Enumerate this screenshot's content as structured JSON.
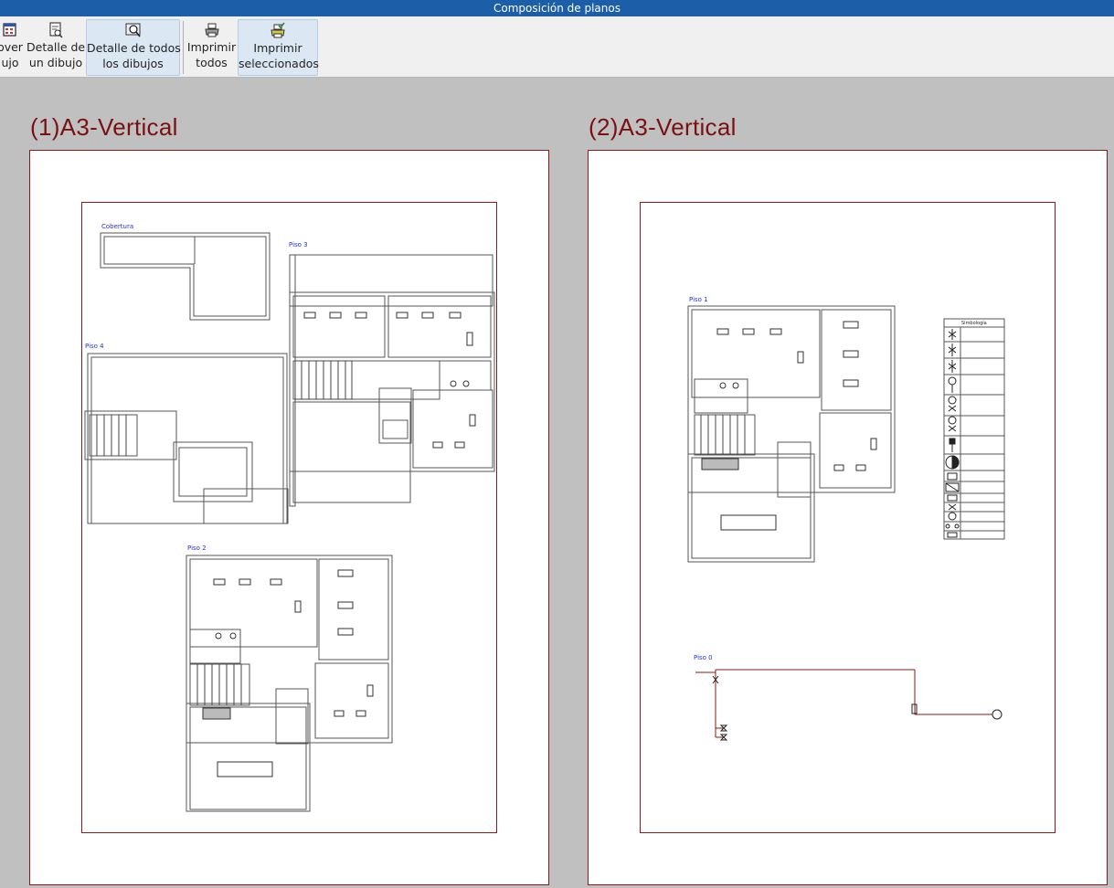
{
  "window": {
    "title": "Composición de planos"
  },
  "toolbar": {
    "move": {
      "line1": "over",
      "line2": "ujo"
    },
    "detail_one": {
      "line1": "Detalle de",
      "line2": "un dibujo"
    },
    "detail_all": {
      "line1": "Detalle de todos",
      "line2": "los dibujos"
    },
    "print_all": {
      "line1": "Imprimir",
      "line2": "todos"
    },
    "print_selected": {
      "line1": "Imprimir",
      "line2": "seleccionados"
    }
  },
  "sheets": [
    {
      "title": "(1)A3-Vertical"
    },
    {
      "title": "(2)A3-Vertical"
    }
  ],
  "drawings": {
    "cobertura": "Cobertura",
    "piso3": "Piso 3",
    "piso4": "Piso 4",
    "piso2": "Piso 2",
    "piso1": "Piso 1",
    "piso0": "Piso 0",
    "simbologia": "Simbología"
  },
  "colors": {
    "title_bar": "#1c5fa8",
    "sheet_title": "#7a1111",
    "sheet_border": "#8b1a1a",
    "drawing_label": "#2233cc",
    "background": "#c0c0c0"
  }
}
